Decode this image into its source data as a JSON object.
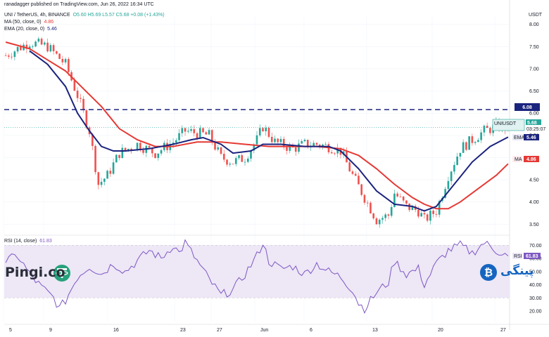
{
  "header": {
    "published": "ranadagger published on TradingView.com, Jun 26, 2022 16:34 UTC",
    "symbol": "UNI / TetherUS, 4h, BINANCE",
    "ohlc": "O5.60 H5.69 L5.57 C5.68 +0.08 (+1.43%)",
    "ma_label": "MA (50, close, 0)",
    "ma_value": "4.86",
    "ema_label": "EMA (20, close, 0)",
    "ema_value": "5.46",
    "currency": "USDT",
    "rsi_label": "RSI (14, close)",
    "rsi_value": "61.83"
  },
  "tags": {
    "resistance": "6.08",
    "pair": "UNIUSDT",
    "price": "5.68",
    "countdown": "03:25:07",
    "ema_tag": "EMA",
    "ema_val": "5.46",
    "ma_tag": "MA",
    "ma_val": "4.86",
    "rsi_tag": "RSI",
    "rsi_val": "61.83"
  },
  "watermarks": {
    "left": "Pingi.co",
    "right": "پینگی"
  },
  "colors": {
    "up": "#26a69a",
    "down": "#ef5350",
    "ema": "#1a237e",
    "ma": "#e53935",
    "resistance": "#1a237e",
    "rsi": "#7e57c2",
    "rsi_band": "#ede7f6",
    "tether": "#26a17b",
    "bitcoin": "#1565c0"
  },
  "chart_data": [
    {
      "type": "candlestick",
      "title": "UNI / TetherUS, 4h, BINANCE",
      "x_ticks": [
        "5",
        "9",
        "16",
        "23",
        "27",
        "Jun",
        "6",
        "13",
        "20",
        "27"
      ],
      "y_ticks": [
        "8.00",
        "7.50",
        "7.00",
        "6.50",
        "6.00",
        "5.50",
        "5.00",
        "4.50",
        "4.00",
        "3.50"
      ],
      "ylim": [
        3.3,
        8.2
      ],
      "horizontal_line": 6.08,
      "last_price": 5.68,
      "close_path": [
        [
          0,
          7.3
        ],
        [
          8,
          7.6
        ],
        [
          14,
          7.5
        ],
        [
          20,
          7.1
        ],
        [
          24,
          6.4
        ],
        [
          28,
          5.6
        ],
        [
          31,
          4.4
        ],
        [
          34,
          4.6
        ],
        [
          38,
          5.1
        ],
        [
          44,
          5.3
        ],
        [
          50,
          5.1
        ],
        [
          56,
          5.35
        ],
        [
          60,
          5.6
        ],
        [
          64,
          5.55
        ],
        [
          68,
          5.5
        ],
        [
          72,
          5.0
        ],
        [
          76,
          4.9
        ],
        [
          80,
          5.0
        ],
        [
          84,
          5.4
        ],
        [
          86,
          5.7
        ],
        [
          90,
          5.35
        ],
        [
          96,
          5.2
        ],
        [
          100,
          5.3
        ],
        [
          104,
          5.3
        ],
        [
          108,
          5.25
        ],
        [
          112,
          5.15
        ],
        [
          116,
          4.6
        ],
        [
          120,
          4.1
        ],
        [
          124,
          3.6
        ],
        [
          128,
          3.7
        ],
        [
          130,
          4.2
        ],
        [
          134,
          3.9
        ],
        [
          138,
          3.8
        ],
        [
          140,
          3.6
        ],
        [
          144,
          3.8
        ],
        [
          148,
          4.6
        ],
        [
          152,
          5.2
        ],
        [
          156,
          5.4
        ],
        [
          160,
          5.6
        ],
        [
          164,
          5.7
        ],
        [
          168,
          5.68
        ]
      ],
      "series": [
        {
          "name": "EMA (20, close, 0)",
          "last": 5.46,
          "points": [
            [
              8,
              7.4
            ],
            [
              14,
              7.1
            ],
            [
              20,
              6.6
            ],
            [
              24,
              6.0
            ],
            [
              28,
              5.6
            ],
            [
              32,
              5.25
            ],
            [
              36,
              5.15
            ],
            [
              40,
              5.15
            ],
            [
              48,
              5.2
            ],
            [
              56,
              5.3
            ],
            [
              62,
              5.4
            ],
            [
              66,
              5.45
            ],
            [
              72,
              5.3
            ],
            [
              76,
              5.1
            ],
            [
              82,
              5.15
            ],
            [
              86,
              5.3
            ],
            [
              92,
              5.3
            ],
            [
              100,
              5.25
            ],
            [
              108,
              5.25
            ],
            [
              112,
              5.15
            ],
            [
              118,
              4.75
            ],
            [
              124,
              4.25
            ],
            [
              130,
              3.95
            ],
            [
              136,
              3.9
            ],
            [
              140,
              3.8
            ],
            [
              144,
              3.9
            ],
            [
              150,
              4.4
            ],
            [
              156,
              4.9
            ],
            [
              162,
              5.25
            ],
            [
              168,
              5.46
            ]
          ]
        },
        {
          "name": "MA (50, close, 0)",
          "last": 4.86,
          "points": [
            [
              0,
              7.6
            ],
            [
              8,
              7.45
            ],
            [
              14,
              7.2
            ],
            [
              20,
              6.95
            ],
            [
              26,
              6.55
            ],
            [
              32,
              6.15
            ],
            [
              38,
              5.65
            ],
            [
              44,
              5.4
            ],
            [
              50,
              5.25
            ],
            [
              56,
              5.25
            ],
            [
              64,
              5.35
            ],
            [
              72,
              5.35
            ],
            [
              80,
              5.3
            ],
            [
              88,
              5.25
            ],
            [
              96,
              5.25
            ],
            [
              104,
              5.25
            ],
            [
              112,
              5.2
            ],
            [
              118,
              5.05
            ],
            [
              124,
              4.75
            ],
            [
              130,
              4.4
            ],
            [
              136,
              4.1
            ],
            [
              140,
              3.95
            ],
            [
              144,
              3.85
            ],
            [
              148,
              3.85
            ],
            [
              152,
              4.0
            ],
            [
              158,
              4.3
            ],
            [
              164,
              4.6
            ],
            [
              168,
              4.86
            ]
          ]
        }
      ]
    },
    {
      "type": "line",
      "title": "RSI (14, close)",
      "y_ticks": [
        "70.00",
        "60.00",
        "50.00",
        "40.00",
        "30.00",
        "20.00"
      ],
      "ylim": [
        12,
        76
      ],
      "band": [
        30,
        70
      ],
      "last": 61.83,
      "points": [
        [
          0,
          58
        ],
        [
          4,
          62
        ],
        [
          8,
          48
        ],
        [
          12,
          38
        ],
        [
          16,
          30
        ],
        [
          18,
          22
        ],
        [
          20,
          28
        ],
        [
          24,
          46
        ],
        [
          28,
          54
        ],
        [
          32,
          48
        ],
        [
          36,
          56
        ],
        [
          40,
          50
        ],
        [
          44,
          58
        ],
        [
          48,
          66
        ],
        [
          52,
          60
        ],
        [
          56,
          70
        ],
        [
          58,
          64
        ],
        [
          60,
          72
        ],
        [
          64,
          58
        ],
        [
          68,
          44
        ],
        [
          72,
          32
        ],
        [
          76,
          36
        ],
        [
          80,
          48
        ],
        [
          84,
          62
        ],
        [
          86,
          72
        ],
        [
          88,
          58
        ],
        [
          92,
          52
        ],
        [
          96,
          54
        ],
        [
          100,
          48
        ],
        [
          104,
          56
        ],
        [
          108,
          50
        ],
        [
          112,
          46
        ],
        [
          116,
          36
        ],
        [
          118,
          26
        ],
        [
          120,
          22
        ],
        [
          124,
          34
        ],
        [
          128,
          42
        ],
        [
          130,
          58
        ],
        [
          134,
          48
        ],
        [
          138,
          52
        ],
        [
          140,
          40
        ],
        [
          144,
          56
        ],
        [
          148,
          66
        ],
        [
          152,
          70
        ],
        [
          156,
          64
        ],
        [
          160,
          72
        ],
        [
          164,
          66
        ],
        [
          168,
          61.83
        ]
      ]
    }
  ]
}
